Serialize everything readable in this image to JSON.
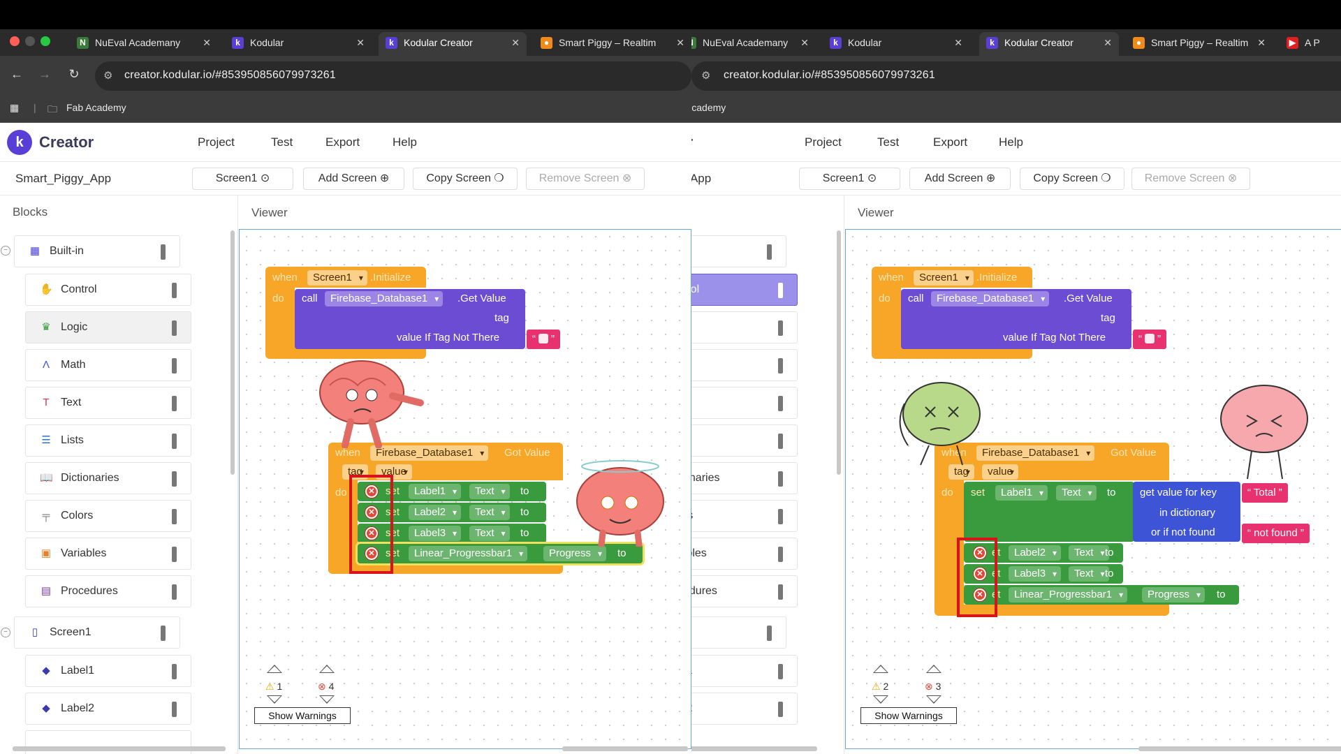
{
  "browser": {
    "tabs": [
      "NuEval Academany",
      "Kodular",
      "Kodular Creator",
      "Smart Piggy – Realtim",
      "A P"
    ],
    "url": "creator.kodular.io/#853950856079973261",
    "bookmark": "Fab Academy",
    "bookmark_partial": "b Academy"
  },
  "app": {
    "brand": "Creator",
    "brand_partial": "or",
    "menu": [
      "Project",
      "Test",
      "Export",
      "Help"
    ],
    "project_name": "Smart_Piggy_App",
    "project_name_partial": "y_App",
    "screen_select": "Screen1",
    "add_screen": "Add Screen",
    "copy_screen": "Copy Screen",
    "remove_screen": "Remove Screen"
  },
  "panels": {
    "blocks": "Blocks",
    "viewer": "Viewer"
  },
  "blocks_list": [
    {
      "label": "Built-in",
      "partial": "n",
      "icon": "grid-icon"
    },
    {
      "label": "Control",
      "partial": "ntrol",
      "icon": "control-icon"
    },
    {
      "label": "Logic",
      "partial": "gic",
      "icon": "logic-icon"
    },
    {
      "label": "Math",
      "partial": "th",
      "icon": "math-icon"
    },
    {
      "label": "Text",
      "partial": "t",
      "icon": "text-icon"
    },
    {
      "label": "Lists",
      "partial": "s",
      "icon": "list-icon"
    },
    {
      "label": "Dictionaries",
      "partial": "tionaries",
      "icon": "dictionary-icon"
    },
    {
      "label": "Colors",
      "partial": "ors",
      "icon": "colors-icon"
    },
    {
      "label": "Variables",
      "partial": "iables",
      "icon": "variables-icon"
    },
    {
      "label": "Procedures",
      "partial": "cedures",
      "icon": "procedures-icon"
    },
    {
      "label": "Screen1",
      "partial": "n1",
      "icon": "phone-icon"
    },
    {
      "label": "Label1",
      "partial": "el1",
      "icon": "label-icon"
    },
    {
      "label": "Label2",
      "partial": "el2",
      "icon": "label-icon"
    }
  ],
  "code": {
    "when": "when",
    "do": "do",
    "call": "call",
    "set": "set",
    "to": "to",
    "et": "et",
    "screen1": "Screen1",
    "initialize": ".Initialize",
    "firebase": "Firebase_Database1",
    "get_value": ".Get Value",
    "got_value": "Got Value",
    "tag": "tag",
    "value": "value",
    "value_if_not_there": "value If Tag Not There",
    "label1": "Label1",
    "label2": "Label2",
    "label3": "Label3",
    "text_prop": "Text",
    "progressbar": "Linear_Progressbar1",
    "progress_prop": "Progress",
    "get_value_for_key": "get value for key",
    "in_dictionary": "in dictionary",
    "or_if_not_found": "or if not found",
    "total": "Total",
    "not_found": "not found"
  },
  "warnings": {
    "left": {
      "warn": "1",
      "err": "4"
    },
    "right": {
      "warn": "2",
      "err": "3"
    },
    "show_label": "Show Warnings"
  },
  "colors": {
    "event": "#f7a628",
    "component": "#6b4cd2",
    "setter": "#3a9a3e",
    "text": "#e7326f",
    "dictionary": "#3e54d6",
    "highlight": "#d8131b"
  }
}
